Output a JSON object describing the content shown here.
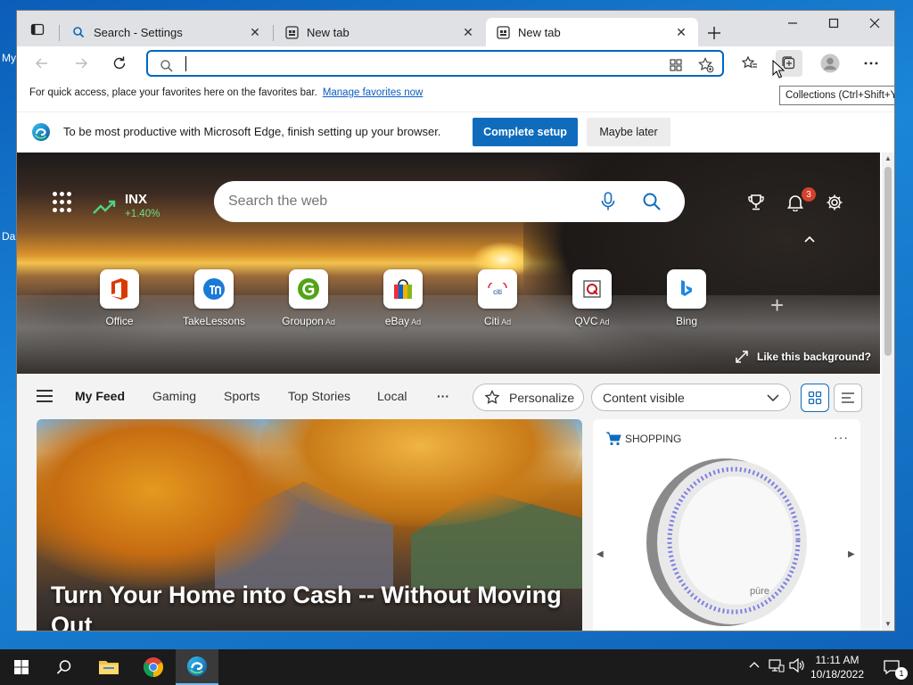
{
  "desktop": {
    "left_labels": [
      "My",
      "Da"
    ]
  },
  "window": {
    "tabs": [
      {
        "title": "Search - Settings",
        "icon": "search-icon"
      },
      {
        "title": "New tab",
        "icon": "newtab-icon"
      },
      {
        "title": "New tab",
        "icon": "newtab-icon",
        "active": true
      }
    ]
  },
  "toolbar": {
    "address_value": "",
    "tooltip": "Collections (Ctrl+Shift+Y)"
  },
  "favbar": {
    "message": "For quick access, place your favorites here on the favorites bar.",
    "link": "Manage favorites now"
  },
  "setupbar": {
    "message": "To be most productive with Microsoft Edge, finish setting up your browser.",
    "complete_label": "Complete setup",
    "maybe_label": "Maybe later"
  },
  "hero": {
    "stock_symbol": "INX",
    "stock_change": "+1.40%",
    "search_placeholder": "Search the web",
    "notifications_count": "3",
    "like_background": "Like this background?"
  },
  "quick_links": [
    {
      "label": "Office",
      "ad": ""
    },
    {
      "label": "TakeLessons",
      "ad": ""
    },
    {
      "label": "Groupon",
      "ad": "Ad"
    },
    {
      "label": "eBay",
      "ad": "Ad"
    },
    {
      "label": "Citi",
      "ad": "Ad"
    },
    {
      "label": "QVC",
      "ad": "Ad"
    },
    {
      "label": "Bing",
      "ad": ""
    }
  ],
  "feed": {
    "tabs": [
      "My Feed",
      "Gaming",
      "Sports",
      "Top Stories",
      "Local"
    ],
    "more": "···",
    "personalize": "Personalize",
    "content_select": "Content visible",
    "main_card_title": "Turn Your Home into Cash -- Without Moving Out",
    "shopping_label": "SHOPPING",
    "product_brand": "pūre"
  },
  "taskbar": {
    "time": "11:11 AM",
    "date": "10/18/2022",
    "notification_count": "1"
  },
  "colors": {
    "accent": "#0f6cbd",
    "stock_up": "#6ede8a",
    "badge": "#d7402c"
  }
}
